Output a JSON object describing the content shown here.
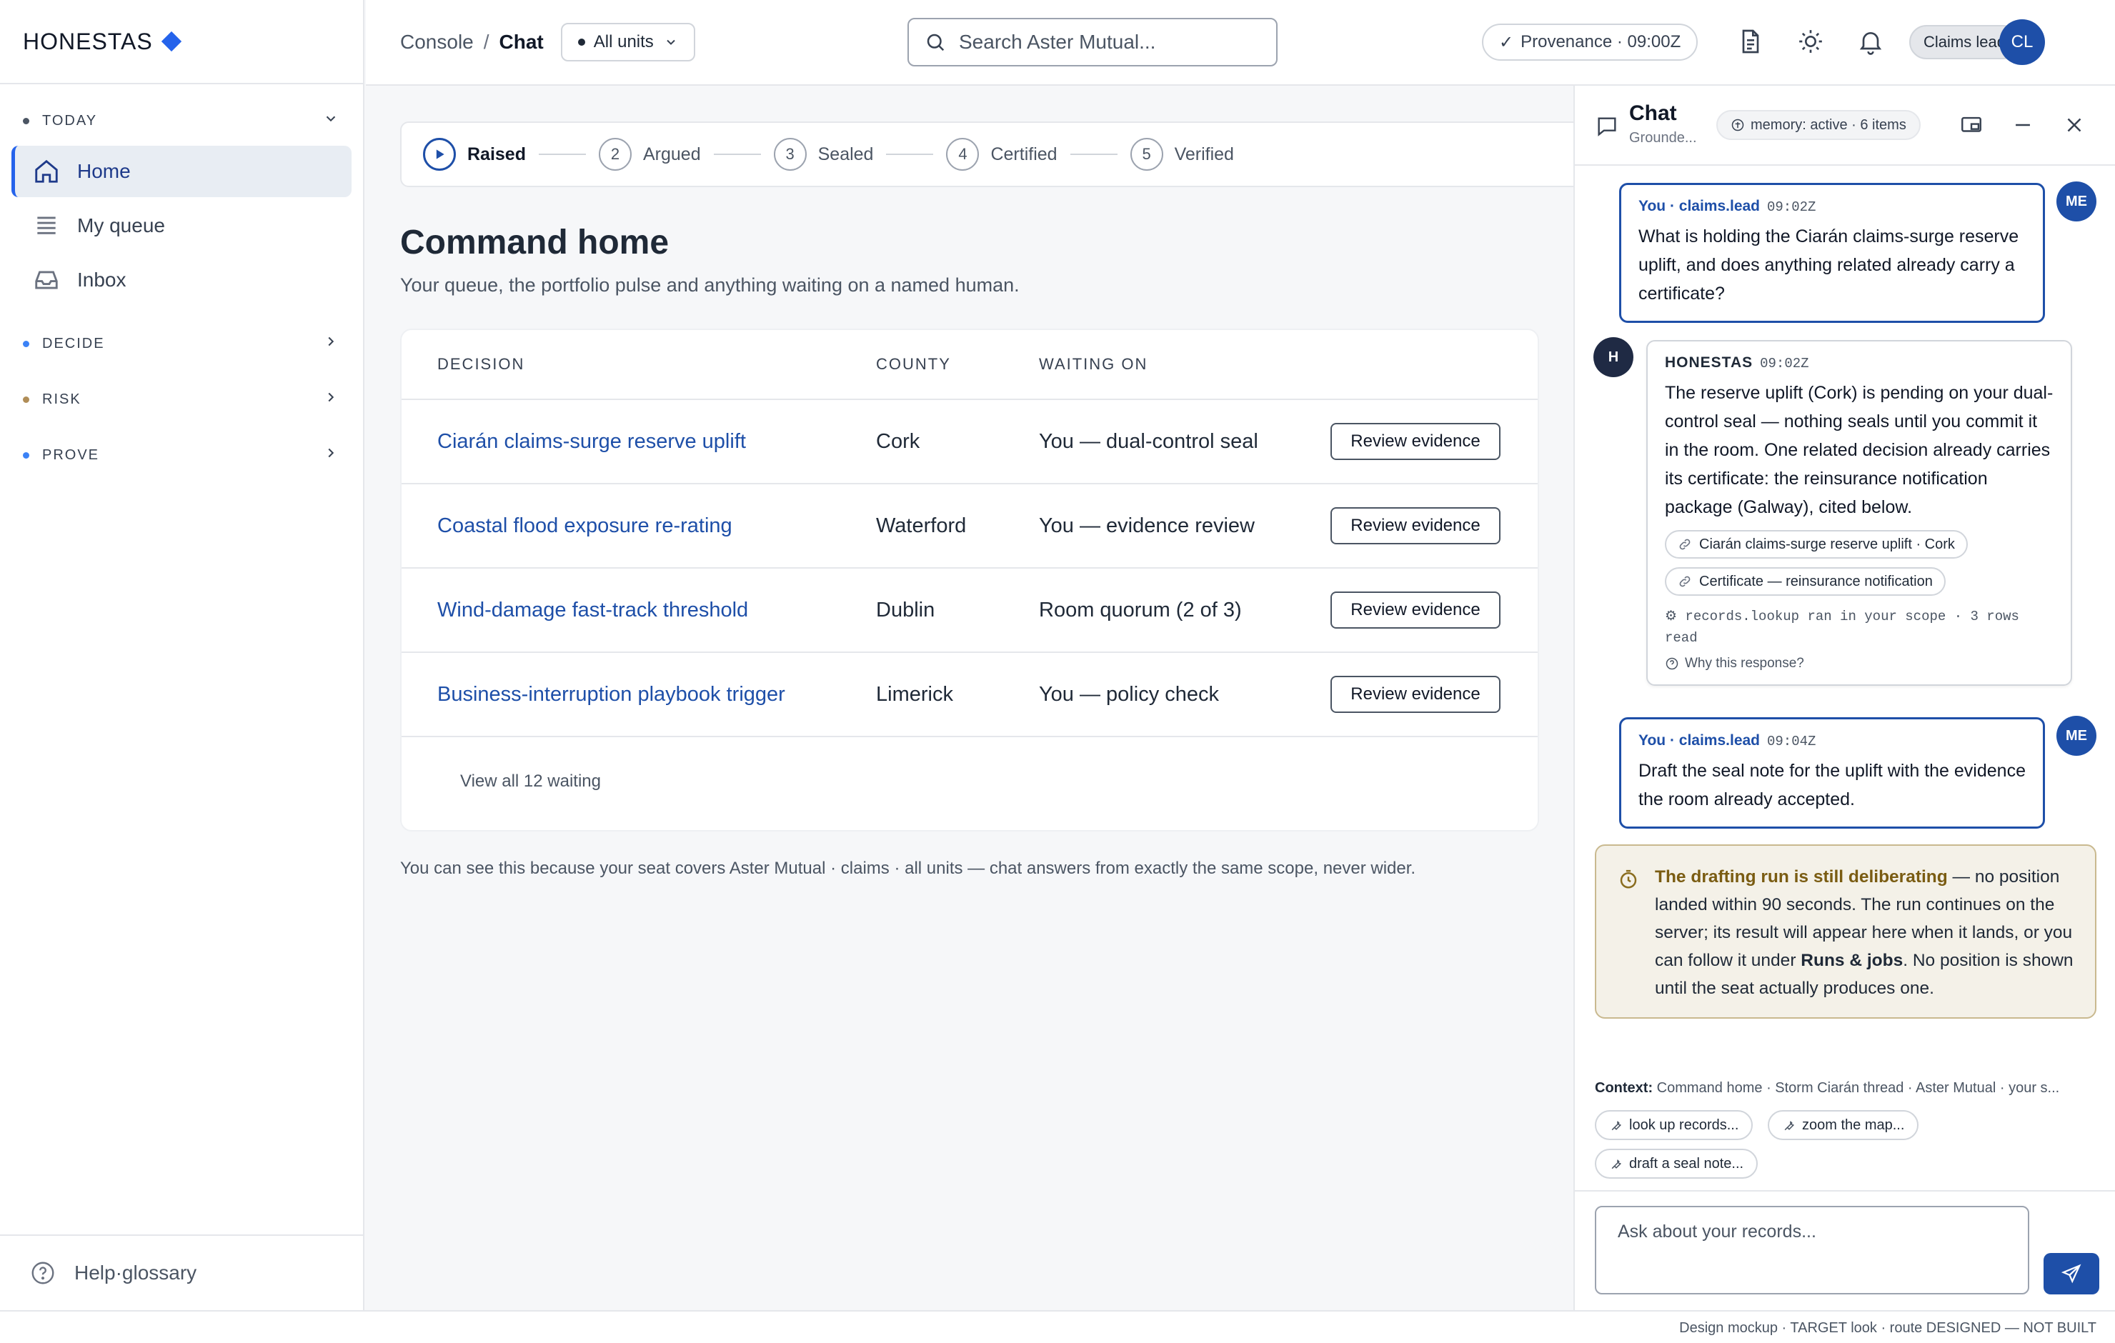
{
  "brand": {
    "name": "HONESTAS"
  },
  "sidebar": {
    "groups": [
      {
        "label": "TODAY"
      },
      {
        "label": "DECIDE"
      },
      {
        "label": "RISK"
      },
      {
        "label": "PROVE"
      }
    ],
    "items": [
      {
        "label": "Home",
        "icon": "home-icon"
      },
      {
        "label": "My queue",
        "icon": "list-icon"
      },
      {
        "label": "Inbox",
        "icon": "inbox-icon"
      }
    ],
    "footer": {
      "label": "Help·glossary",
      "icon": "help-icon"
    }
  },
  "topbar": {
    "breadcrumb": [
      "Console",
      "Chat"
    ],
    "breadcrumb_sep": "/",
    "unit_select": "All units",
    "search_placeholder": "Search Aster Mutual...",
    "provenance": "Provenance · 09:00Z",
    "role": "Claims lead",
    "avatar_initials": "CL"
  },
  "stepper": [
    {
      "num": "",
      "label": "Raised",
      "active": true
    },
    {
      "num": "2",
      "label": "Argued"
    },
    {
      "num": "3",
      "label": "Sealed"
    },
    {
      "num": "4",
      "label": "Certified"
    },
    {
      "num": "5",
      "label": "Verified"
    }
  ],
  "main": {
    "title": "Command home",
    "subtitle": "Your queue, the portfolio pulse and anything waiting on a named human.",
    "table": {
      "headers": [
        "DECISION",
        "COUNTY",
        "WAITING ON"
      ],
      "rows": [
        {
          "decision": "Ciarán claims-surge reserve uplift",
          "county": "Cork",
          "waiting": "You — dual-control seal",
          "action": "Review evidence"
        },
        {
          "decision": "Coastal flood exposure re-rating",
          "county": "Waterford",
          "waiting": "You — evidence review",
          "action": "Review evidence"
        },
        {
          "decision": "Wind-damage fast-track threshold",
          "county": "Dublin",
          "waiting": "Room quorum (2 of 3)",
          "action": "Review evidence"
        },
        {
          "decision": "Business-interruption playbook trigger",
          "county": "Limerick",
          "waiting": "You — policy check",
          "action": "Review evidence"
        }
      ],
      "view_all": "View all 12 waiting"
    },
    "scope_note": "You can see this because your seat covers Aster Mutual · claims · all units — chat answers from exactly the same scope, never wider."
  },
  "chat": {
    "title": "Chat",
    "subtitle": "Grounde...",
    "memory": "memory: active · 6 items",
    "messages": [
      {
        "who": "You · claims.lead",
        "ts": "09:02Z",
        "avatar": "ME",
        "text": "What is holding the Ciarán claims-surge reserve uplift, and does anything related already carry a certificate?"
      },
      {
        "who": "HONESTAS",
        "ts": "09:02Z",
        "avatar": "H",
        "text": "The reserve uplift (Cork) is pending on your dual-control seal — nothing seals until you commit it in the room. One related decision already carries its certificate: the reinsurance notification package (Galway), cited below.",
        "cites": [
          "Ciarán claims-surge reserve uplift · Cork",
          "Certificate — reinsurance notification"
        ],
        "tool_run": "⚙ records.lookup ran in your scope · 3 rows read",
        "why": "Why this response?"
      },
      {
        "who": "You · claims.lead",
        "ts": "09:04Z",
        "avatar": "ME",
        "text": "Draft the seal note for the uplift with the evidence the room already accepted."
      }
    ],
    "status": {
      "strong": "The drafting run is still deliberating",
      "text1": " — no position landed within 90 seconds. The run continues on the server; its result will appear here when it lands, or you can follow it under ",
      "link": "Runs & jobs",
      "text2": ". No position is shown until the seat actually produces one."
    },
    "context_key": "Context:",
    "context_value": "Command home · Storm Ciarán thread · Aster Mutual · your s...",
    "tools": [
      "look up records...",
      "zoom the map...",
      "draft a seal note..."
    ],
    "input_placeholder": "Ask about your records..."
  },
  "footer_note": "Design mockup · TARGET look · route DESIGNED — NOT BUILT",
  "colors": {
    "accent": "#1e4fa8",
    "brand_diamond": "#2563eb",
    "warn_bg": "#f4f1e8",
    "warn_text": "#7a5c12"
  }
}
